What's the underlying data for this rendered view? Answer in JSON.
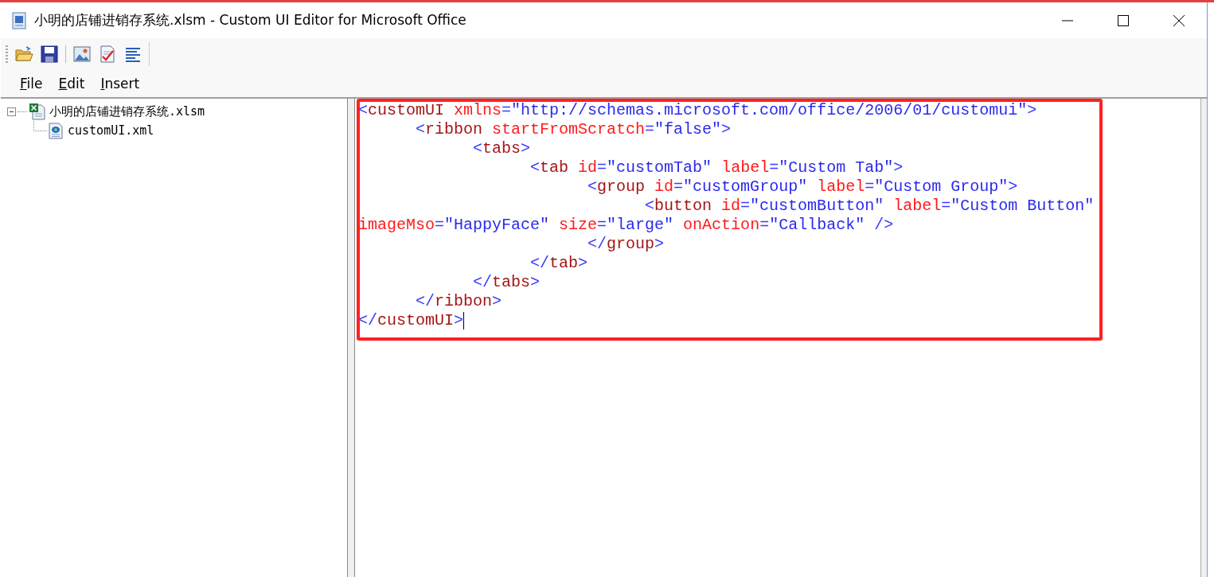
{
  "window": {
    "title": "小明的店铺进销存系统.xlsm - Custom UI Editor for Microsoft Office"
  },
  "toolbar": {
    "buttons": [
      {
        "kind": "open"
      },
      {
        "kind": "save"
      },
      {
        "kind": "image"
      },
      {
        "kind": "validate"
      },
      {
        "kind": "format"
      }
    ]
  },
  "menu": [
    {
      "label": "File"
    },
    {
      "label": "Edit"
    },
    {
      "label": "Insert"
    }
  ],
  "tree": [
    {
      "label": "小明的店铺进销存系统.xlsm",
      "kind": "workbook",
      "expanded": true,
      "children": [
        {
          "label": "customUI.xml",
          "kind": "xml"
        }
      ]
    }
  ],
  "editor": {
    "lines": [
      [
        {
          "text": "<",
          "kind": "punct"
        },
        {
          "text": "customUI",
          "kind": "tag"
        },
        {
          "text": " xmlns",
          "kind": "attr"
        },
        {
          "text": "=",
          "kind": "punct"
        },
        {
          "text": "\"http://schemas.microsoft.com/office/2006/01/customui\"",
          "kind": "value"
        },
        {
          "text": ">",
          "kind": "punct"
        }
      ],
      [
        {
          "text": "      <",
          "kind": "punct"
        },
        {
          "text": "ribbon",
          "kind": "tag"
        },
        {
          "text": " startFromScratch",
          "kind": "attr"
        },
        {
          "text": "=",
          "kind": "punct"
        },
        {
          "text": "\"false\"",
          "kind": "value"
        },
        {
          "text": ">",
          "kind": "punct"
        }
      ],
      [
        {
          "text": "            <",
          "kind": "punct"
        },
        {
          "text": "tabs",
          "kind": "tag"
        },
        {
          "text": ">",
          "kind": "punct"
        }
      ],
      [
        {
          "text": "                  <",
          "kind": "punct"
        },
        {
          "text": "tab",
          "kind": "tag"
        },
        {
          "text": " id",
          "kind": "attr"
        },
        {
          "text": "=",
          "kind": "punct"
        },
        {
          "text": "\"customTab\"",
          "kind": "value"
        },
        {
          "text": " label",
          "kind": "attr"
        },
        {
          "text": "=",
          "kind": "punct"
        },
        {
          "text": "\"Custom Tab\"",
          "kind": "value"
        },
        {
          "text": ">",
          "kind": "punct"
        }
      ],
      [
        {
          "text": "                        <",
          "kind": "punct"
        },
        {
          "text": "group",
          "kind": "tag"
        },
        {
          "text": " id",
          "kind": "attr"
        },
        {
          "text": "=",
          "kind": "punct"
        },
        {
          "text": "\"customGroup\"",
          "kind": "value"
        },
        {
          "text": " label",
          "kind": "attr"
        },
        {
          "text": "=",
          "kind": "punct"
        },
        {
          "text": "\"Custom Group\"",
          "kind": "value"
        },
        {
          "text": ">",
          "kind": "punct"
        }
      ],
      [
        {
          "text": "                              <",
          "kind": "punct"
        },
        {
          "text": "button",
          "kind": "tag"
        },
        {
          "text": " id",
          "kind": "attr"
        },
        {
          "text": "=",
          "kind": "punct"
        },
        {
          "text": "\"customButton\"",
          "kind": "value"
        },
        {
          "text": " label",
          "kind": "attr"
        },
        {
          "text": "=",
          "kind": "punct"
        },
        {
          "text": "\"Custom Button\"",
          "kind": "value"
        }
      ],
      [
        {
          "text": "imageMso",
          "kind": "attr"
        },
        {
          "text": "=",
          "kind": "punct"
        },
        {
          "text": "\"HappyFace\"",
          "kind": "value"
        },
        {
          "text": " size",
          "kind": "attr"
        },
        {
          "text": "=",
          "kind": "punct"
        },
        {
          "text": "\"large\"",
          "kind": "value"
        },
        {
          "text": " onAction",
          "kind": "attr"
        },
        {
          "text": "=",
          "kind": "punct"
        },
        {
          "text": "\"Callback\"",
          "kind": "value"
        },
        {
          "text": " />",
          "kind": "punct"
        }
      ],
      [
        {
          "text": "                        </",
          "kind": "punct"
        },
        {
          "text": "group",
          "kind": "tag"
        },
        {
          "text": ">",
          "kind": "punct"
        }
      ],
      [
        {
          "text": "                  </",
          "kind": "punct"
        },
        {
          "text": "tab",
          "kind": "tag"
        },
        {
          "text": ">",
          "kind": "punct"
        }
      ],
      [
        {
          "text": "            </",
          "kind": "punct"
        },
        {
          "text": "tabs",
          "kind": "tag"
        },
        {
          "text": ">",
          "kind": "punct"
        }
      ],
      [
        {
          "text": "      </",
          "kind": "punct"
        },
        {
          "text": "ribbon",
          "kind": "tag"
        },
        {
          "text": ">",
          "kind": "punct"
        }
      ],
      [
        {
          "text": "</",
          "kind": "punct"
        },
        {
          "text": "customUI",
          "kind": "tag"
        },
        {
          "text": ">",
          "kind": "punct"
        }
      ]
    ]
  }
}
